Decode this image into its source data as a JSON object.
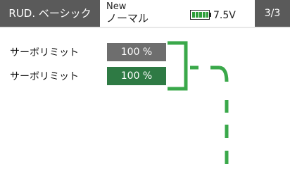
{
  "header": {
    "title": "RUD. ベーシック",
    "condition_new": "New",
    "condition_name": "ノーマル",
    "battery_voltage": "7.5V",
    "page_indicator": "3/3"
  },
  "rows": [
    {
      "label": "サーボリミット",
      "value": "100 %"
    },
    {
      "label": "サーボリミット",
      "value": "100 %"
    }
  ],
  "colors": {
    "tab_bg": "#5a5a5a",
    "accent_green": "#3aa84a",
    "value_grey": "#6e6e6e",
    "value_green": "#2e7a44"
  },
  "icons": {
    "battery": "battery-icon"
  }
}
